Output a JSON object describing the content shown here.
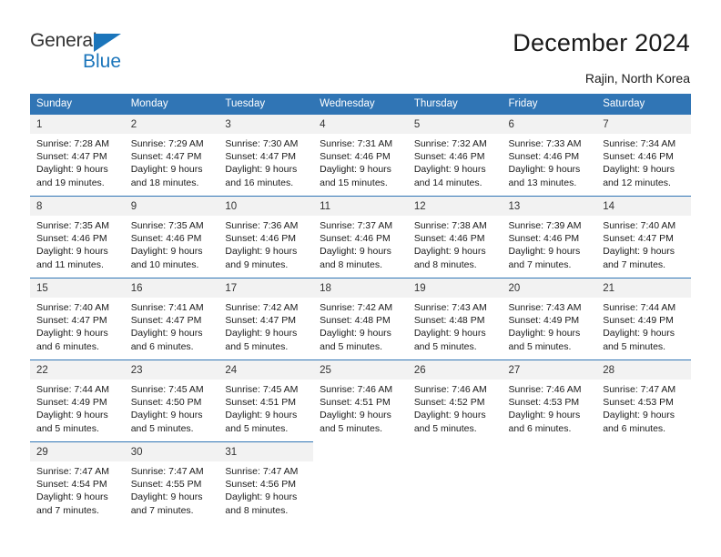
{
  "logo": {
    "word_one": "General",
    "word_two": "Blue",
    "triangle_color": "#1b75bb"
  },
  "header": {
    "title": "December 2024",
    "location": "Rajin, North Korea"
  },
  "theme": {
    "header_blue": "#3075b5",
    "daynum_band": "#f2f2f2",
    "text": "#1a1a1a"
  },
  "calendar": {
    "weekday_headers": [
      "Sunday",
      "Monday",
      "Tuesday",
      "Wednesday",
      "Thursday",
      "Friday",
      "Saturday"
    ],
    "weeks": [
      [
        {
          "day": "1",
          "sunrise": "Sunrise: 7:28 AM",
          "sunset": "Sunset: 4:47 PM",
          "daylight1": "Daylight: 9 hours",
          "daylight2": "and 19 minutes."
        },
        {
          "day": "2",
          "sunrise": "Sunrise: 7:29 AM",
          "sunset": "Sunset: 4:47 PM",
          "daylight1": "Daylight: 9 hours",
          "daylight2": "and 18 minutes."
        },
        {
          "day": "3",
          "sunrise": "Sunrise: 7:30 AM",
          "sunset": "Sunset: 4:47 PM",
          "daylight1": "Daylight: 9 hours",
          "daylight2": "and 16 minutes."
        },
        {
          "day": "4",
          "sunrise": "Sunrise: 7:31 AM",
          "sunset": "Sunset: 4:46 PM",
          "daylight1": "Daylight: 9 hours",
          "daylight2": "and 15 minutes."
        },
        {
          "day": "5",
          "sunrise": "Sunrise: 7:32 AM",
          "sunset": "Sunset: 4:46 PM",
          "daylight1": "Daylight: 9 hours",
          "daylight2": "and 14 minutes."
        },
        {
          "day": "6",
          "sunrise": "Sunrise: 7:33 AM",
          "sunset": "Sunset: 4:46 PM",
          "daylight1": "Daylight: 9 hours",
          "daylight2": "and 13 minutes."
        },
        {
          "day": "7",
          "sunrise": "Sunrise: 7:34 AM",
          "sunset": "Sunset: 4:46 PM",
          "daylight1": "Daylight: 9 hours",
          "daylight2": "and 12 minutes."
        }
      ],
      [
        {
          "day": "8",
          "sunrise": "Sunrise: 7:35 AM",
          "sunset": "Sunset: 4:46 PM",
          "daylight1": "Daylight: 9 hours",
          "daylight2": "and 11 minutes."
        },
        {
          "day": "9",
          "sunrise": "Sunrise: 7:35 AM",
          "sunset": "Sunset: 4:46 PM",
          "daylight1": "Daylight: 9 hours",
          "daylight2": "and 10 minutes."
        },
        {
          "day": "10",
          "sunrise": "Sunrise: 7:36 AM",
          "sunset": "Sunset: 4:46 PM",
          "daylight1": "Daylight: 9 hours",
          "daylight2": "and 9 minutes."
        },
        {
          "day": "11",
          "sunrise": "Sunrise: 7:37 AM",
          "sunset": "Sunset: 4:46 PM",
          "daylight1": "Daylight: 9 hours",
          "daylight2": "and 8 minutes."
        },
        {
          "day": "12",
          "sunrise": "Sunrise: 7:38 AM",
          "sunset": "Sunset: 4:46 PM",
          "daylight1": "Daylight: 9 hours",
          "daylight2": "and 8 minutes."
        },
        {
          "day": "13",
          "sunrise": "Sunrise: 7:39 AM",
          "sunset": "Sunset: 4:46 PM",
          "daylight1": "Daylight: 9 hours",
          "daylight2": "and 7 minutes."
        },
        {
          "day": "14",
          "sunrise": "Sunrise: 7:40 AM",
          "sunset": "Sunset: 4:47 PM",
          "daylight1": "Daylight: 9 hours",
          "daylight2": "and 7 minutes."
        }
      ],
      [
        {
          "day": "15",
          "sunrise": "Sunrise: 7:40 AM",
          "sunset": "Sunset: 4:47 PM",
          "daylight1": "Daylight: 9 hours",
          "daylight2": "and 6 minutes."
        },
        {
          "day": "16",
          "sunrise": "Sunrise: 7:41 AM",
          "sunset": "Sunset: 4:47 PM",
          "daylight1": "Daylight: 9 hours",
          "daylight2": "and 6 minutes."
        },
        {
          "day": "17",
          "sunrise": "Sunrise: 7:42 AM",
          "sunset": "Sunset: 4:47 PM",
          "daylight1": "Daylight: 9 hours",
          "daylight2": "and 5 minutes."
        },
        {
          "day": "18",
          "sunrise": "Sunrise: 7:42 AM",
          "sunset": "Sunset: 4:48 PM",
          "daylight1": "Daylight: 9 hours",
          "daylight2": "and 5 minutes."
        },
        {
          "day": "19",
          "sunrise": "Sunrise: 7:43 AM",
          "sunset": "Sunset: 4:48 PM",
          "daylight1": "Daylight: 9 hours",
          "daylight2": "and 5 minutes."
        },
        {
          "day": "20",
          "sunrise": "Sunrise: 7:43 AM",
          "sunset": "Sunset: 4:49 PM",
          "daylight1": "Daylight: 9 hours",
          "daylight2": "and 5 minutes."
        },
        {
          "day": "21",
          "sunrise": "Sunrise: 7:44 AM",
          "sunset": "Sunset: 4:49 PM",
          "daylight1": "Daylight: 9 hours",
          "daylight2": "and 5 minutes."
        }
      ],
      [
        {
          "day": "22",
          "sunrise": "Sunrise: 7:44 AM",
          "sunset": "Sunset: 4:49 PM",
          "daylight1": "Daylight: 9 hours",
          "daylight2": "and 5 minutes."
        },
        {
          "day": "23",
          "sunrise": "Sunrise: 7:45 AM",
          "sunset": "Sunset: 4:50 PM",
          "daylight1": "Daylight: 9 hours",
          "daylight2": "and 5 minutes."
        },
        {
          "day": "24",
          "sunrise": "Sunrise: 7:45 AM",
          "sunset": "Sunset: 4:51 PM",
          "daylight1": "Daylight: 9 hours",
          "daylight2": "and 5 minutes."
        },
        {
          "day": "25",
          "sunrise": "Sunrise: 7:46 AM",
          "sunset": "Sunset: 4:51 PM",
          "daylight1": "Daylight: 9 hours",
          "daylight2": "and 5 minutes."
        },
        {
          "day": "26",
          "sunrise": "Sunrise: 7:46 AM",
          "sunset": "Sunset: 4:52 PM",
          "daylight1": "Daylight: 9 hours",
          "daylight2": "and 5 minutes."
        },
        {
          "day": "27",
          "sunrise": "Sunrise: 7:46 AM",
          "sunset": "Sunset: 4:53 PM",
          "daylight1": "Daylight: 9 hours",
          "daylight2": "and 6 minutes."
        },
        {
          "day": "28",
          "sunrise": "Sunrise: 7:47 AM",
          "sunset": "Sunset: 4:53 PM",
          "daylight1": "Daylight: 9 hours",
          "daylight2": "and 6 minutes."
        }
      ],
      [
        {
          "day": "29",
          "sunrise": "Sunrise: 7:47 AM",
          "sunset": "Sunset: 4:54 PM",
          "daylight1": "Daylight: 9 hours",
          "daylight2": "and 7 minutes."
        },
        {
          "day": "30",
          "sunrise": "Sunrise: 7:47 AM",
          "sunset": "Sunset: 4:55 PM",
          "daylight1": "Daylight: 9 hours",
          "daylight2": "and 7 minutes."
        },
        {
          "day": "31",
          "sunrise": "Sunrise: 7:47 AM",
          "sunset": "Sunset: 4:56 PM",
          "daylight1": "Daylight: 9 hours",
          "daylight2": "and 8 minutes."
        },
        null,
        null,
        null,
        null
      ]
    ]
  }
}
